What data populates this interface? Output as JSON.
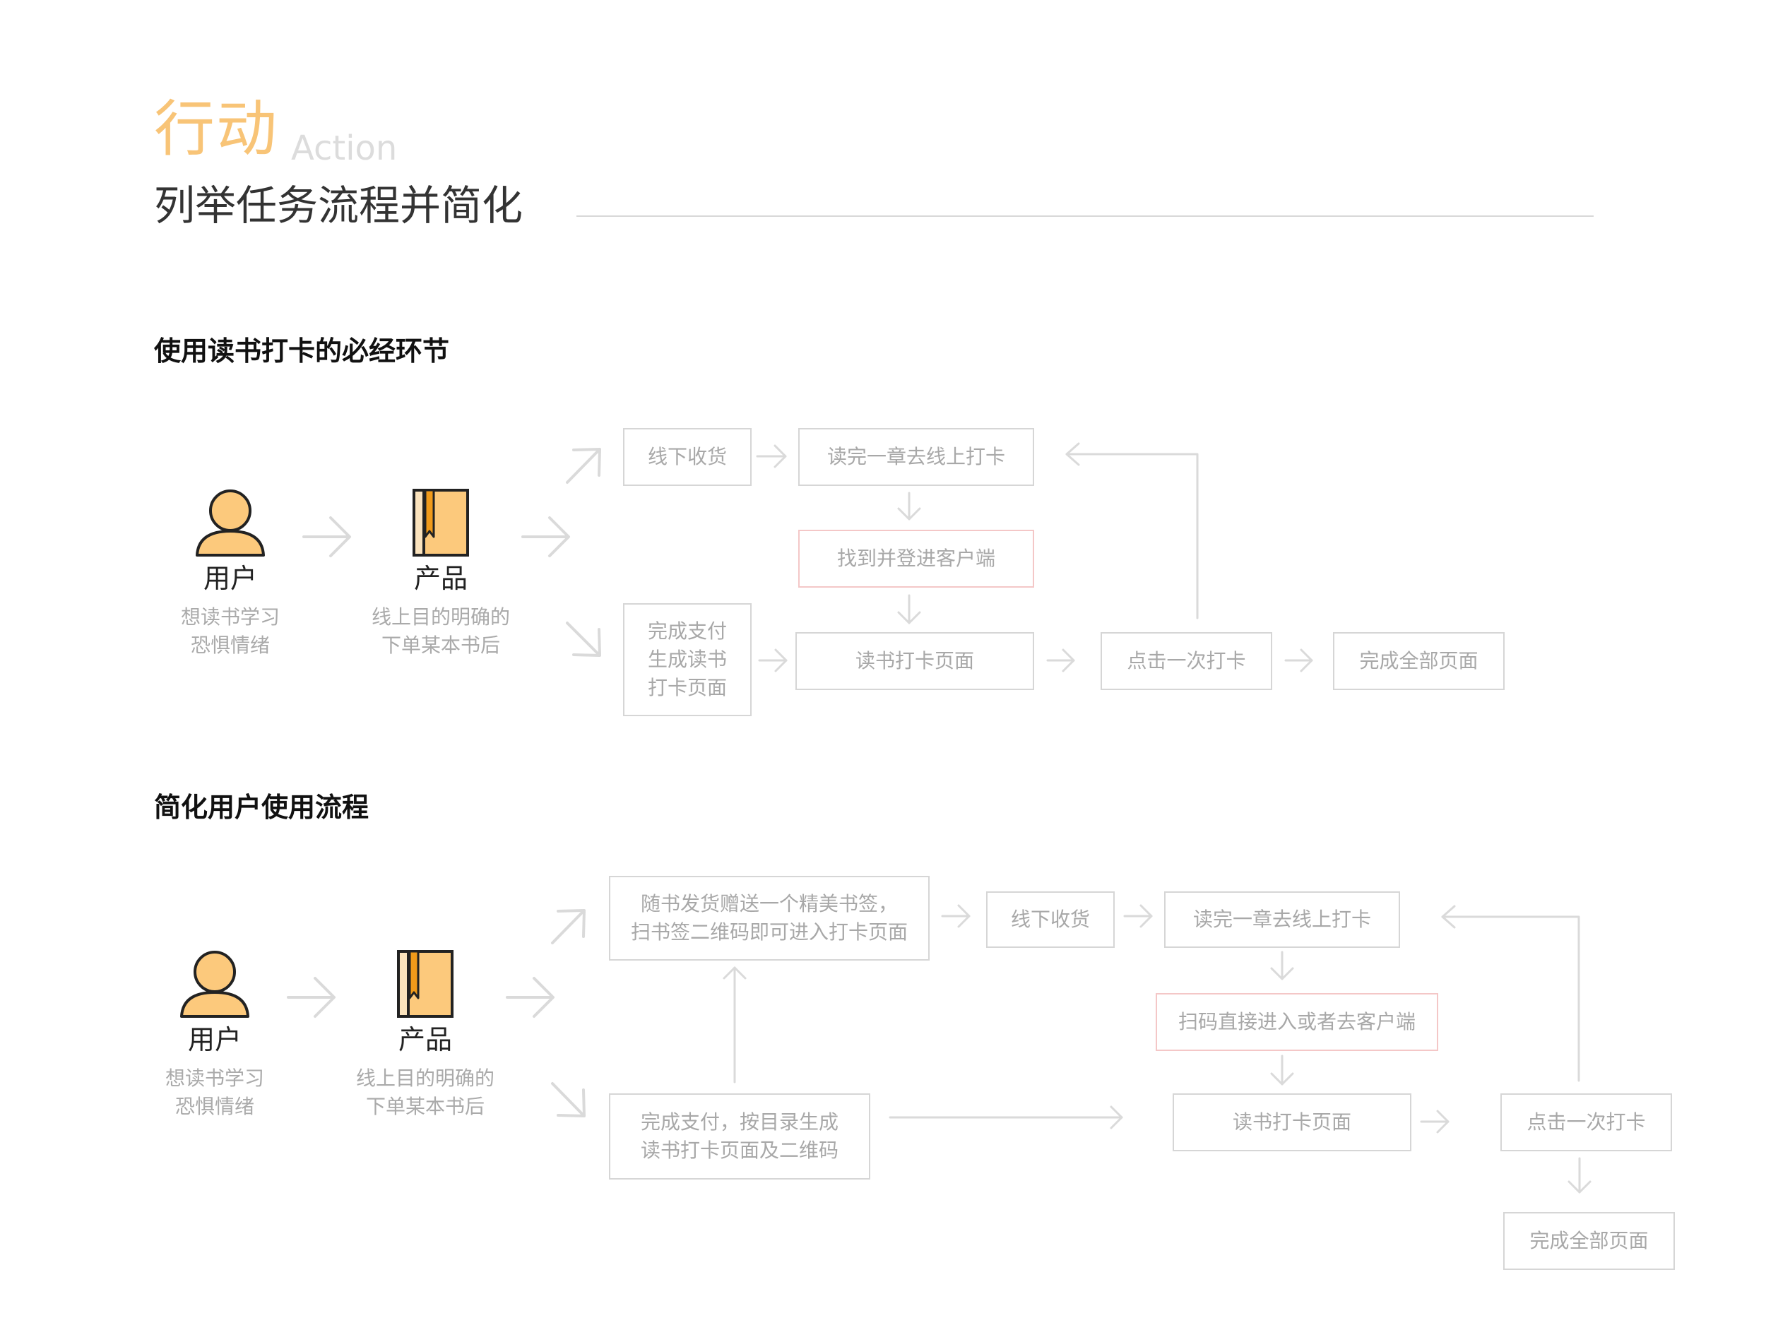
{
  "header": {
    "title_cn": "行动",
    "title_en": "Action",
    "subtitle": "列举任务流程并简化"
  },
  "section1": {
    "title": "使用读书打卡的必经环节",
    "user": {
      "name": "用户",
      "desc": "想读书学习\n恐惧情绪"
    },
    "product": {
      "name": "产品",
      "desc": "线上目的明确的\n下单某本书后"
    },
    "boxes": {
      "offline_receive": "线下收货",
      "read_chapter": "读完一章去线上打卡",
      "find_login": "找到并登进客户端",
      "pay_generate": "完成支付\n生成读书\n打卡页面",
      "checkin_page": "读书打卡页面",
      "click_checkin": "点击一次打卡",
      "complete_all": "完成全部页面"
    }
  },
  "section2": {
    "title": "简化用户使用流程",
    "user": {
      "name": "用户",
      "desc": "想读书学习\n恐惧情绪"
    },
    "product": {
      "name": "产品",
      "desc": "线上目的明确的\n下单某本书后"
    },
    "boxes": {
      "bookmark_gift": "随书发货赠送一个精美书签，\n扫书签二维码即可进入打卡页面",
      "offline_receive": "线下收货",
      "read_chapter": "读完一章去线上打卡",
      "scan_enter": "扫码直接进入或者去客户端",
      "pay_generate": "完成支付，按目录生成\n读书打卡页面及二维码",
      "checkin_page": "读书打卡页面",
      "click_checkin": "点击一次打卡",
      "complete_all": "完成全部页面"
    }
  },
  "colors": {
    "accent": "#f8c477",
    "icon_fill": "#fcc97c",
    "icon_dark": "#f09a1a",
    "line": "#d6d6d6",
    "highlight_border": "#f4c7c7"
  },
  "icons": [
    "user-icon",
    "book-icon",
    "arrow-icon"
  ]
}
